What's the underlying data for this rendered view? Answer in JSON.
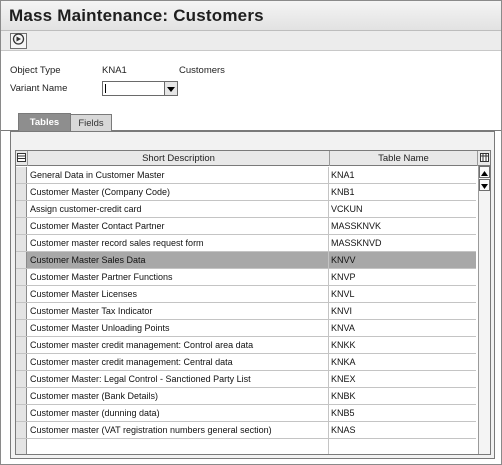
{
  "window": {
    "title": "Mass Maintenance: Customers"
  },
  "toolbar": {
    "execute_icon": "execute-icon"
  },
  "form": {
    "object_type_label": "Object Type",
    "object_type_value": "KNA1",
    "object_type_desc": "Customers",
    "variant_label": "Variant Name",
    "variant_value": ""
  },
  "tabs": [
    {
      "label": "Tables",
      "active": true
    },
    {
      "label": "Fields",
      "active": false
    }
  ],
  "table": {
    "columns": [
      "Short Description",
      "Table Name"
    ],
    "rows": [
      {
        "desc": "General Data in Customer Master",
        "name": "KNA1"
      },
      {
        "desc": "Customer Master (Company Code)",
        "name": "KNB1"
      },
      {
        "desc": "Assign customer-credit card",
        "name": "VCKUN"
      },
      {
        "desc": "Customer Master Contact Partner",
        "name": "MASSKNVK"
      },
      {
        "desc": "Customer master record sales request form",
        "name": "MASSKNVD"
      },
      {
        "desc": "Customer Master Sales Data",
        "name": "KNVV"
      },
      {
        "desc": "Customer Master Partner Functions",
        "name": "KNVP"
      },
      {
        "desc": "Customer Master Licenses",
        "name": "KNVL"
      },
      {
        "desc": "Customer Master Tax Indicator",
        "name": "KNVI"
      },
      {
        "desc": "Customer Master Unloading Points",
        "name": "KNVA"
      },
      {
        "desc": "Customer master credit management: Control area data",
        "name": "KNKK"
      },
      {
        "desc": "Customer master credit management: Central data",
        "name": "KNKA"
      },
      {
        "desc": "Customer Master: Legal Control - Sanctioned Party List",
        "name": "KNEX"
      },
      {
        "desc": "Customer master (Bank Details)",
        "name": "KNBK"
      },
      {
        "desc": "Customer master (dunning data)",
        "name": "KNB5"
      },
      {
        "desc": "Customer master (VAT registration numbers general section)",
        "name": "KNAS"
      }
    ],
    "selected_index": 5
  }
}
